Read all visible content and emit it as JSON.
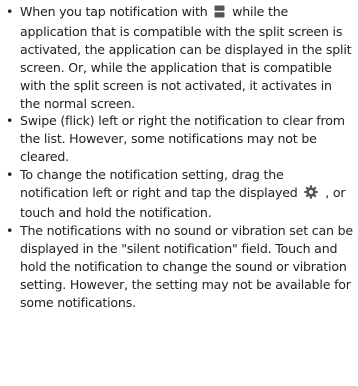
{
  "bullet_symbol": "•",
  "items": [
    {
      "before": "When you tap notification with",
      "icon": "split-screen-icon",
      "after": "while the application that is compatible with the split screen is activated, the application can be displayed in the split screen. Or, while the application that is compatible with the split screen is not activated, it activates in the normal screen."
    },
    {
      "text": "Swipe (flick) left or right the notification to clear from the list. However, some notifications may not be cleared."
    },
    {
      "before": "To change the notification setting, drag the notification left or right and tap the displayed",
      "icon": "gear-icon",
      "after": ", or touch and hold the notification."
    },
    {
      "text": "The notifications with no sound or vibration set can be displayed in the \"silent notification\" field. Touch and hold the notification to change the sound or vibration setting. However, the setting may not be available for some notifications."
    }
  ],
  "colors": {
    "text": "#222222",
    "icon": "#555555"
  }
}
